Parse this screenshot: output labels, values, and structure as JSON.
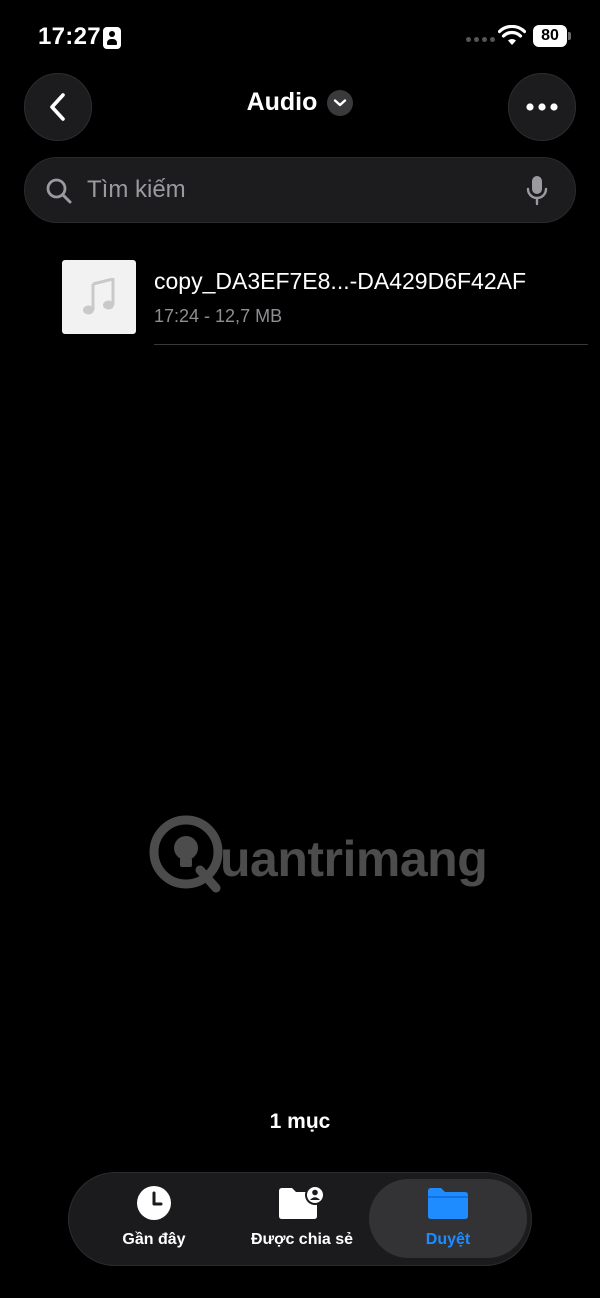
{
  "status_bar": {
    "time": "17:27",
    "battery": "80"
  },
  "nav": {
    "title": "Audio"
  },
  "search": {
    "placeholder": "Tìm kiếm"
  },
  "files": [
    {
      "name": "copy_DA3EF7E8...-DA429D6F42AF",
      "meta": "17:24 - 12,7 MB",
      "icon": "music-note-icon"
    }
  ],
  "watermark": {
    "text": "uantrimang"
  },
  "footer": {
    "item_count": "1 mục"
  },
  "tabs": [
    {
      "label": "Gần đây",
      "icon": "clock-icon",
      "active": false
    },
    {
      "label": "Được chia sẻ",
      "icon": "shared-folder-icon",
      "active": false
    },
    {
      "label": "Duyệt",
      "icon": "folder-icon",
      "active": true
    }
  ],
  "colors": {
    "accent": "#1e8cff",
    "background": "#000000",
    "surface": "#1c1c1e",
    "secondary_text": "#8e8e93"
  }
}
